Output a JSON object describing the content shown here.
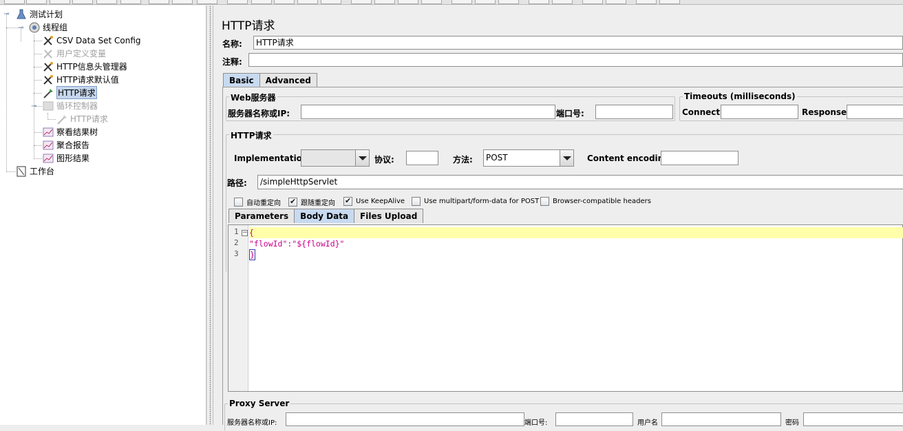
{
  "tree": {
    "items": [
      {
        "label": "测试计划",
        "icon": "flask-icon"
      },
      {
        "label": "线程组",
        "icon": "gear-icon"
      },
      {
        "label": "CSV Data Set Config",
        "icon": "wrench-icon"
      },
      {
        "label": "用户定义变量",
        "icon": "wrench-icon",
        "disabled": true
      },
      {
        "label": "HTTP信息头管理器",
        "icon": "wrench-icon"
      },
      {
        "label": "HTTP请求默认值",
        "icon": "wrench-icon"
      },
      {
        "label": "HTTP请求",
        "icon": "pipette-icon",
        "selected": true
      },
      {
        "label": "循环控制器",
        "icon": "loop-controller-icon",
        "disabled": true
      },
      {
        "label": "HTTP请求",
        "icon": "pipette-icon",
        "disabled": true
      },
      {
        "label": "察看结果树",
        "icon": "graph-icon"
      },
      {
        "label": "聚合报告",
        "icon": "graph-icon"
      },
      {
        "label": "图形结果",
        "icon": "graph-icon"
      },
      {
        "label": "工作台",
        "icon": "workbench-icon"
      }
    ]
  },
  "main": {
    "title": "HTTP请求",
    "name_label": "名称:",
    "name_value": "HTTP请求",
    "comment_label": "注释:",
    "comment_value": "",
    "tabs": [
      {
        "label": "Basic",
        "active": true
      },
      {
        "label": "Advanced"
      }
    ],
    "web_server": {
      "title": "Web服务器",
      "server_label": "服务器名称或IP:",
      "server_value": "",
      "port_label": "端口号:",
      "port_value": ""
    },
    "timeouts": {
      "title": "Timeouts (milliseconds)",
      "connect_label": "Connect:",
      "connect_value": "",
      "response_label": "Response:",
      "response_value": ""
    },
    "http_request": {
      "title": "HTTP请求",
      "implementation_label": "Implementation:",
      "implementation_value": "",
      "protocol_label": "协议:",
      "protocol_value": "",
      "method_label": "方法:",
      "method_value": "POST",
      "encoding_label": "Content encoding:",
      "encoding_value": "",
      "path_label": "路径:",
      "path_value": "/simpleHttpServlet"
    },
    "checkboxes": [
      {
        "label": "自动重定向",
        "checked": false
      },
      {
        "label": "跟随重定向",
        "checked": true
      },
      {
        "label": "Use KeepAlive",
        "checked": true
      },
      {
        "label": "Use multipart/form-data for POST",
        "checked": false
      },
      {
        "label": "Browser-compatible headers",
        "checked": false
      }
    ],
    "body_tabs": [
      {
        "label": "Parameters"
      },
      {
        "label": "Body Data",
        "active": true
      },
      {
        "label": "Files Upload"
      }
    ],
    "editor": {
      "line_numbers": [
        "1",
        "2",
        "3"
      ],
      "line1": "{",
      "line2": "\"flowId\":\"${flowId}\"",
      "line3": "}"
    },
    "proxy": {
      "title": "Proxy Server",
      "server_label": "服务器名称或IP:",
      "port_label": "端口号:",
      "user_label": "用户名",
      "password_label": "密码"
    }
  }
}
